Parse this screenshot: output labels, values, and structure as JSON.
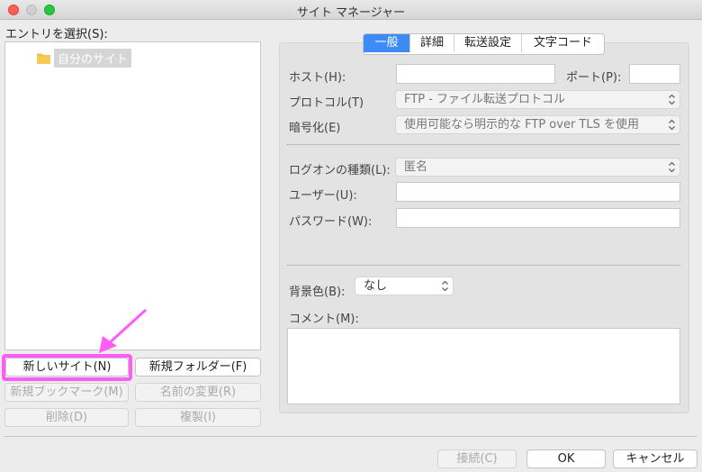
{
  "window": {
    "title": "サイト マネージャー"
  },
  "entry_select_label": "エントリを選択(S):",
  "tree": {
    "items": [
      {
        "label": "自分のサイト"
      }
    ]
  },
  "left_buttons": {
    "new_site": "新しいサイト(N)",
    "new_folder": "新規フォルダー(F)",
    "new_bookmark": "新規ブックマーク(M)",
    "rename": "名前の変更(R)",
    "delete": "削除(D)",
    "duplicate": "複製(I)"
  },
  "tabs": [
    {
      "label": "一般",
      "active": true
    },
    {
      "label": "詳細",
      "active": false
    },
    {
      "label": "転送設定",
      "active": false
    },
    {
      "label": "文字コード",
      "active": false
    }
  ],
  "form": {
    "host_label": "ホスト(H):",
    "host_value": "",
    "port_label": "ポート(P):",
    "port_value": "",
    "protocol_label": "プロトコル(T)",
    "protocol_value": "FTP - ファイル転送プロトコル",
    "encryption_label": "暗号化(E)",
    "encryption_value": "使用可能なら明示的な FTP over TLS を使用",
    "logon_label": "ログオンの種類(L):",
    "logon_value": "匿名",
    "user_label": "ユーザー(U):",
    "user_value": "",
    "password_label": "パスワード(W):",
    "password_value": "",
    "bgcolor_label": "背景色(B):",
    "bgcolor_value": "なし",
    "comment_label": "コメント(M):",
    "comment_value": ""
  },
  "footer": {
    "connect": "接続(C)",
    "ok": "OK",
    "cancel": "キャンセル"
  },
  "colors": {
    "accent": "#3d8bf7",
    "highlight": "#ff5df5",
    "folder": "#f5c142"
  }
}
